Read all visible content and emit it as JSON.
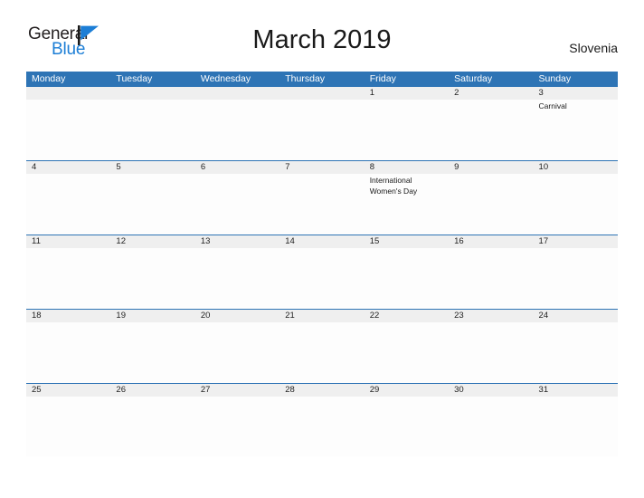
{
  "brand": {
    "name_part1": "General",
    "name_part2": "Blue",
    "flag_color": "#1c7ed6"
  },
  "header": {
    "title": "March 2019",
    "region": "Slovenia"
  },
  "theme": {
    "header_blue": "#2e74b5",
    "date_band_gray": "#efefef",
    "cell_white": "#fdfdfd",
    "text_dark": "#1a1a1a"
  },
  "calendar": {
    "weekdays": [
      "Monday",
      "Tuesday",
      "Wednesday",
      "Thursday",
      "Friday",
      "Saturday",
      "Sunday"
    ],
    "weeks": [
      [
        {
          "date": "",
          "events": []
        },
        {
          "date": "",
          "events": []
        },
        {
          "date": "",
          "events": []
        },
        {
          "date": "",
          "events": []
        },
        {
          "date": "1",
          "events": []
        },
        {
          "date": "2",
          "events": []
        },
        {
          "date": "3",
          "events": [
            "Carnival"
          ]
        }
      ],
      [
        {
          "date": "4",
          "events": []
        },
        {
          "date": "5",
          "events": []
        },
        {
          "date": "6",
          "events": []
        },
        {
          "date": "7",
          "events": []
        },
        {
          "date": "8",
          "events": [
            "International Women's Day"
          ]
        },
        {
          "date": "9",
          "events": []
        },
        {
          "date": "10",
          "events": []
        }
      ],
      [
        {
          "date": "11",
          "events": []
        },
        {
          "date": "12",
          "events": []
        },
        {
          "date": "13",
          "events": []
        },
        {
          "date": "14",
          "events": []
        },
        {
          "date": "15",
          "events": []
        },
        {
          "date": "16",
          "events": []
        },
        {
          "date": "17",
          "events": []
        }
      ],
      [
        {
          "date": "18",
          "events": []
        },
        {
          "date": "19",
          "events": []
        },
        {
          "date": "20",
          "events": []
        },
        {
          "date": "21",
          "events": []
        },
        {
          "date": "22",
          "events": []
        },
        {
          "date": "23",
          "events": []
        },
        {
          "date": "24",
          "events": []
        }
      ],
      [
        {
          "date": "25",
          "events": []
        },
        {
          "date": "26",
          "events": []
        },
        {
          "date": "27",
          "events": []
        },
        {
          "date": "28",
          "events": []
        },
        {
          "date": "29",
          "events": []
        },
        {
          "date": "30",
          "events": []
        },
        {
          "date": "31",
          "events": []
        }
      ]
    ]
  }
}
